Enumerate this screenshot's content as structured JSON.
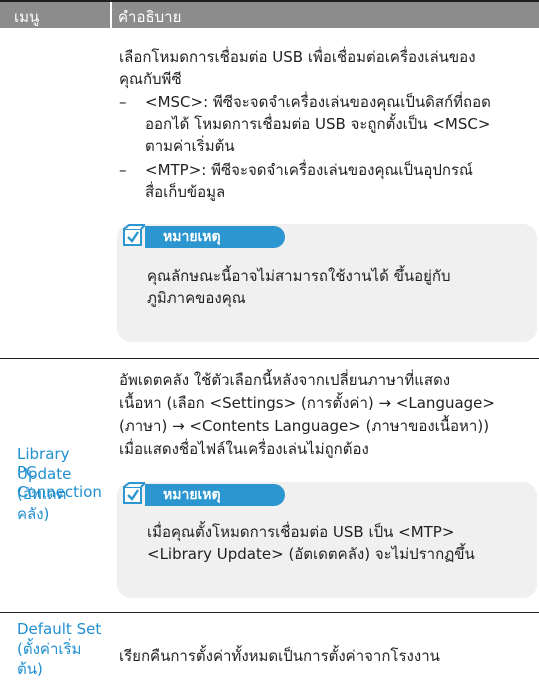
{
  "header": {
    "col1": "เมนู",
    "col2": "คำอธิบาย"
  },
  "rows": [
    {
      "name": [
        "PC",
        "Connection"
      ],
      "lines": [
        "เลือกโหมดการเชื่อมต่อ USB เพื่อเชื่อมต่อเครื่องเล่นของ",
        "คุณกับพีซี"
      ],
      "bullets": [
        [
          "<MSC>: พีซีจะจดจำเครื่องเล่นของคุณเป็นดิสก์ที่ถอด",
          "ออกได้  โหมดการเชื่อมต่อ USB จะถูกตั้งเป็น <MSC>",
          "ตามค่าเริ่มต้น"
        ],
        [
          "<MTP>: พีซีจะจดจำเครื่องเล่นของคุณเป็นอุปกรณ์",
          "สื่อเก็บข้อมูล"
        ]
      ],
      "note": {
        "label": "หมายเหตุ",
        "lines": [
          "คุณลักษณะนี้อาจไม่สามารถใช้งานได้  ขึ้นอยู่กับ",
          "ภูมิภาคของคุณ"
        ]
      }
    },
    {
      "name": [
        "Library",
        "Update",
        "(อัพเดต",
        "คลัง)"
      ],
      "lines": [
        "อัพเดตคลัง  ใช้ตัวเลือกนี้หลังจากเปลี่ยนภาษาที่แสดง",
        "เนื้อหา (เลือก <Settings> (การตั้งค่า) → <Language>",
        "(ภาษา) → <Contents Language> (ภาษาของเนื้อหา))",
        "เมื่อแสดงชื่อไฟล์ในเครื่องเล่นไม่ถูกต้อง"
      ],
      "note": {
        "label": "หมายเหตุ",
        "lines": [
          "เมื่อคุณตั้งโหมดการเชื่อมต่อ USB เป็น <MTP>",
          "<Library Update> (อัตเดตคลัง) จะไม่ปรากฏขึ้น"
        ]
      }
    },
    {
      "name": [
        "Default Set",
        "(ตั้งค่าเริ่ม",
        "ต้น)"
      ],
      "lines": [
        "เรียกคืนการตั้งค่าทั้งหมดเป็นการตั้งค่าจากโรงงาน"
      ]
    }
  ],
  "bullet_char": "–",
  "colors": {
    "header_bg": "#8c8c8c",
    "menu_text": "#1f8fd0",
    "note_bg": "#f0f0f0",
    "note_label_bg": "#2c96d0"
  },
  "icon": "note-check-icon"
}
